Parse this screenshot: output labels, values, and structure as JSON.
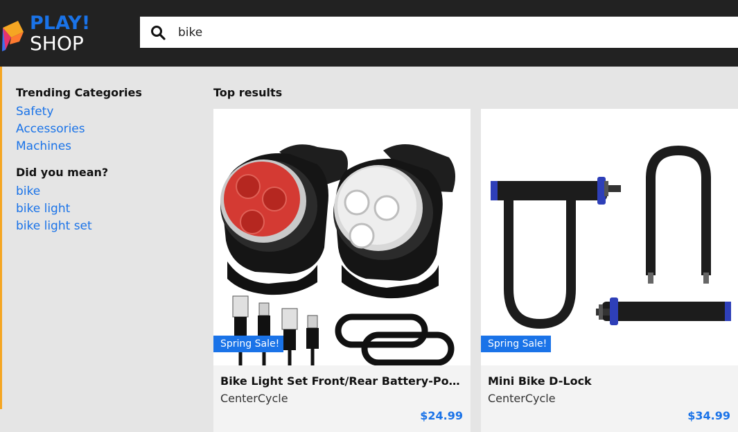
{
  "brand": {
    "line1": "PLAY!",
    "line2": "SHOP"
  },
  "search": {
    "value": "bike",
    "placeholder": "",
    "icon": "search-icon"
  },
  "sidebar": {
    "trending_heading": "Trending Categories",
    "trending": [
      {
        "label": "Safety"
      },
      {
        "label": "Accessories"
      },
      {
        "label": "Machines"
      }
    ],
    "suggest_heading": "Did you mean?",
    "suggestions": [
      {
        "label": "bike"
      },
      {
        "label": "bike light"
      },
      {
        "label": "bike light set"
      }
    ]
  },
  "results": {
    "title": "Top results",
    "items": [
      {
        "badge": "Spring Sale!",
        "name": "Bike Light Set Front/Rear Battery-Powered",
        "vendor": "CenterCycle",
        "price": "$24.99",
        "image": "bike-light-set-image"
      },
      {
        "badge": "Spring Sale!",
        "name": "Mini Bike D-Lock",
        "vendor": "CenterCycle",
        "price": "$34.99",
        "image": "bike-d-lock-image"
      }
    ]
  },
  "colors": {
    "topbar": "#222222",
    "accent": "#1a73e8",
    "sidebar_accent": "#f5a623",
    "background": "#e5e5e5"
  }
}
